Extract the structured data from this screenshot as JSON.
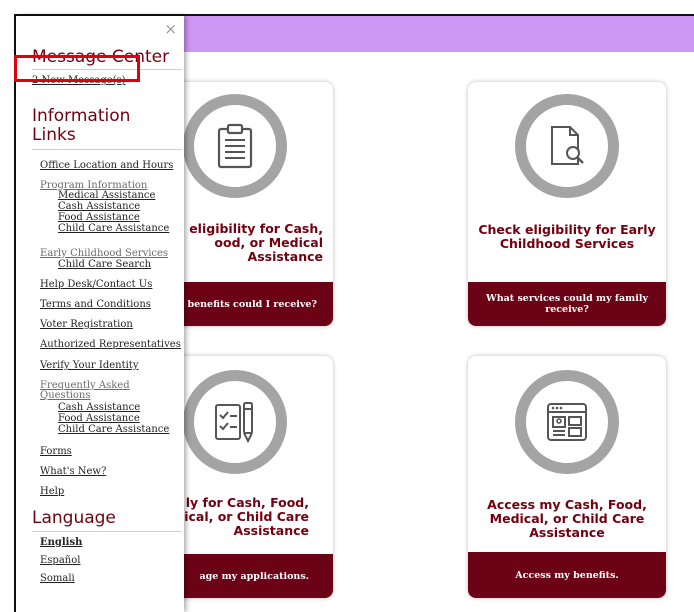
{
  "sidebar": {
    "close_glyph": "×",
    "message_center": {
      "heading": "Message Center",
      "new_messages": "2 New Message(s)"
    },
    "info_links": {
      "heading_line1": "Information",
      "heading_line2": "Links",
      "office": "Office Location and Hours",
      "program_info": "Program Information",
      "program_sub": [
        "Medical Assistance",
        "Cash Assistance",
        "Food Assistance",
        "Child Care Assistance"
      ],
      "early_childhood": "Early Childhood Services",
      "child_care_search": "Child Care Search",
      "help_desk": "Help Desk/Contact Us",
      "terms": "Terms and Conditions",
      "voter": "Voter Registration",
      "authorized": "Authorized Representatives",
      "verify": "Verify Your Identity",
      "faq_line1": "Frequently Asked",
      "faq_line2": "Questions",
      "faq_sub": [
        "Cash Assistance",
        "Food Assistance",
        "Child Care Assistance"
      ],
      "forms": "Forms",
      "whats_new": "What's New?",
      "help": "Help"
    },
    "language": {
      "heading": "Language",
      "options": [
        "English",
        "Español",
        "Somali"
      ]
    }
  },
  "tiles": {
    "cash_eligibility": {
      "title": "eligibility for Cash,\nood, or Medical\nAssistance",
      "bar": "benefits could I receive?"
    },
    "early_childhood": {
      "title": "Check eligibility for Early\nChildhood Services",
      "bar": "What services could my family\nreceive?"
    },
    "apply": {
      "title": "ly for Cash, Food,\nical, or Child Care\nAssistance",
      "bar": "age my applications."
    },
    "access": {
      "title": "Access my Cash, Food,\nMedical, or Child Care\nAssistance",
      "bar": "Access my benefits."
    }
  },
  "colors": {
    "accent_bar": "#cf97f4",
    "maroon": "#6c0215",
    "title_maroon": "#74000f",
    "ring_gray": "#a4a4a4",
    "highlight_red": "#e1000e"
  },
  "icons": [
    "clipboard-icon",
    "document-search-icon",
    "checklist-pen-icon",
    "dashboard-window-icon"
  ]
}
